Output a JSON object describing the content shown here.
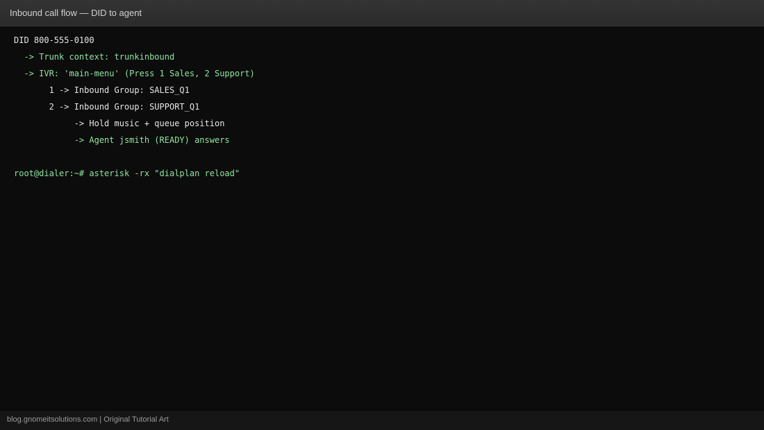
{
  "window": {
    "title": "Inbound call flow — DID to agent"
  },
  "terminal": {
    "lines": [
      "DID 800-555-0100",
      "  -> Trunk context: trunkinbound",
      "  -> IVR: 'main-menu' (Press 1 Sales, 2 Support)",
      "       1 -> Inbound Group: SALES_Q1",
      "       2 -> Inbound Group: SUPPORT_Q1",
      "            -> Hold music + queue position",
      "            -> Agent jsmith (READY) answers",
      "",
      "root@dialer:~# asterisk -rx \"dialplan reload\""
    ],
    "colors": {
      "default_text": "#e6e6e6",
      "accent_text": "#8fe3a0",
      "background": "#0c0c0c"
    }
  },
  "footer": {
    "credit": "blog.gnomeitsolutions.com | Original Tutorial Art"
  }
}
